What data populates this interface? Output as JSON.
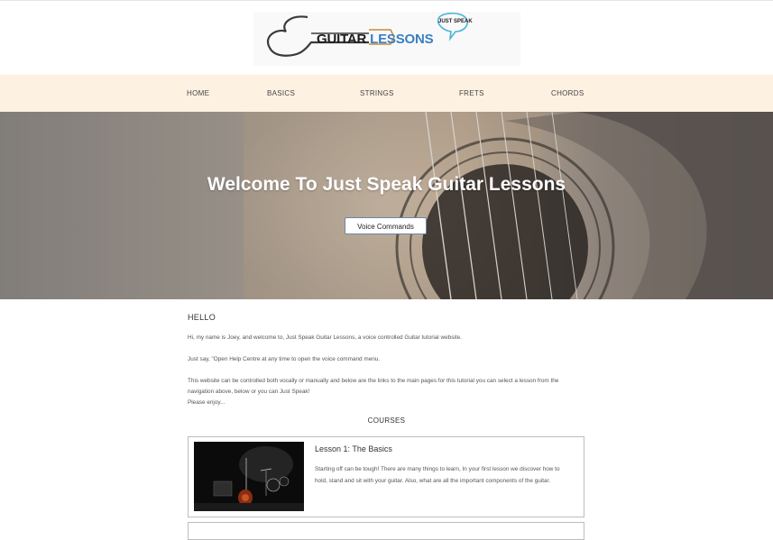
{
  "logo": {
    "title_part1": "GUITAR",
    "title_part2": "LESSONS",
    "tagline": "JUST SPEAK",
    "icon": "guitar-outline-icon"
  },
  "nav": {
    "items": [
      {
        "label": "HOME"
      },
      {
        "label": "BASICS"
      },
      {
        "label": "STRINGS"
      },
      {
        "label": "FRETS"
      },
      {
        "label": "CHORDS"
      }
    ]
  },
  "hero": {
    "title": "Welcome To Just Speak Guitar Lessons",
    "button_label": "Voice Commands"
  },
  "intro": {
    "heading": "HELLO",
    "p1": "Hi, my name is Joey, and welcome to, Just Speak Guitar Lessons, a voice controlled Guitar tutorial website.",
    "p2": "Just say, \"Open Help Centre at any time to open the voice command menu.",
    "p3a": "This website can be controlled both vocally or manually and below are the links to the main pages for this tutorial you can select a lesson from the navigation above, below or you can Just Speak!",
    "p3b": "Please enjoy..."
  },
  "courses": {
    "heading": "COURSES",
    "lessons": [
      {
        "title": "Lesson 1: The Basics",
        "description": "Starting off can be tough! There are many things to learn, In your first lesson we discover how to hold, stand and sit with your guitar. Also, what are all the important components of the guitar."
      }
    ]
  },
  "colors": {
    "nav_bg": "#fdf1e2",
    "logo_blue": "#3a7fc2",
    "speech_bubble": "#4cb3d9"
  }
}
